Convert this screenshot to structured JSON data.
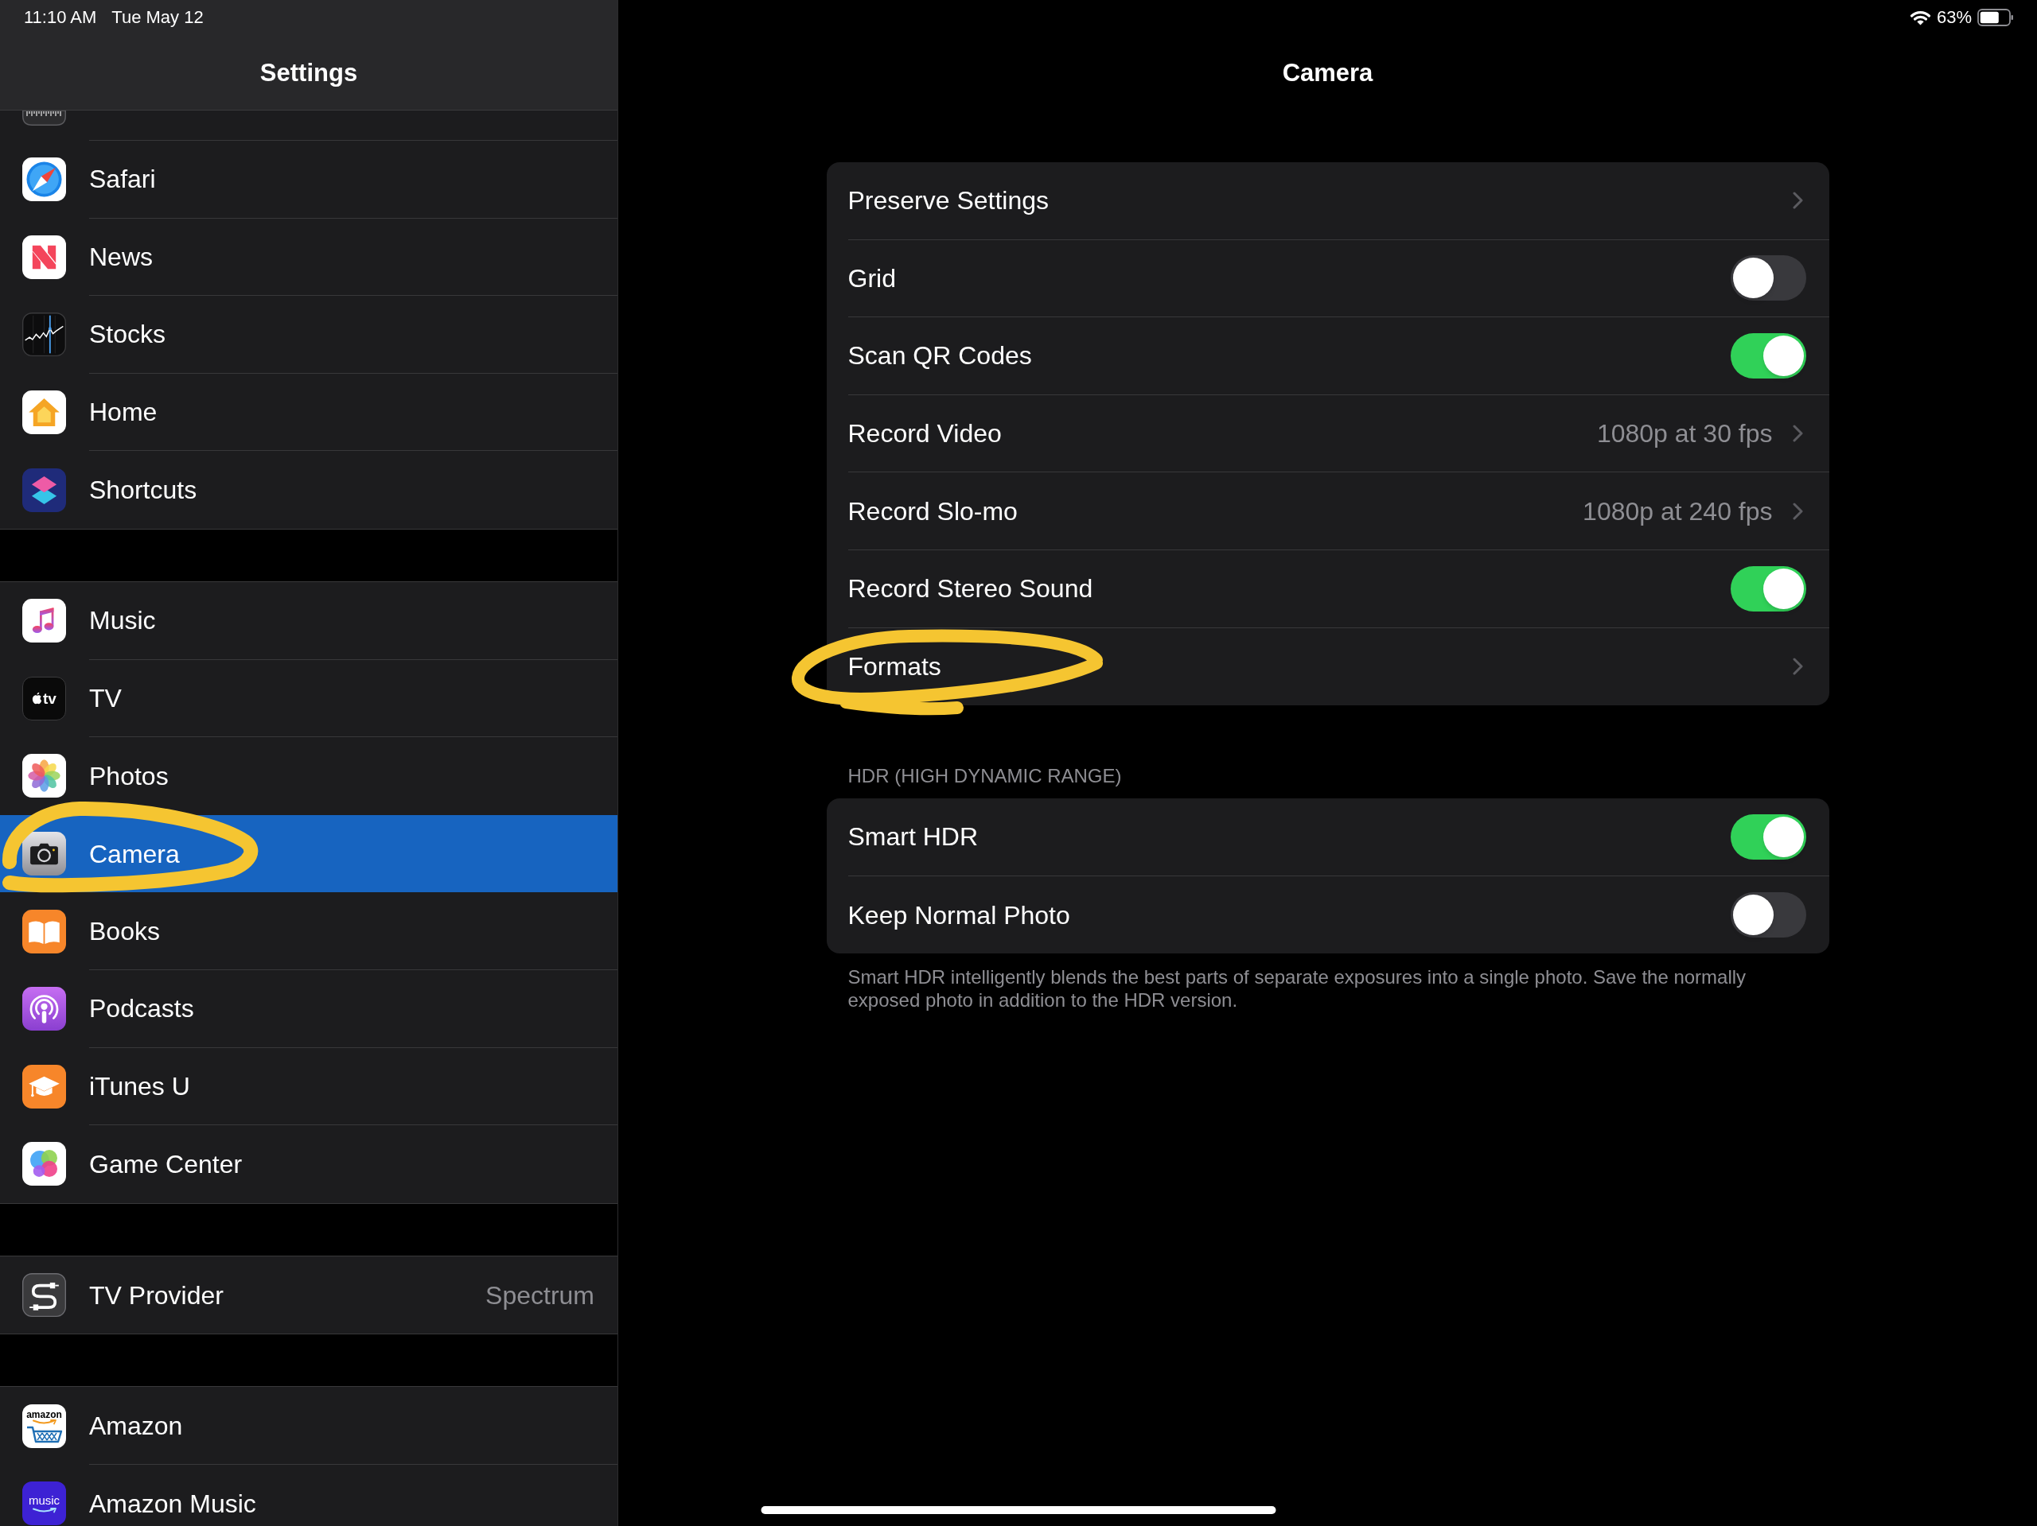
{
  "status_bar": {
    "time": "11:10 AM",
    "date": "Tue May 12",
    "battery": "63%"
  },
  "sidebar": {
    "title": "Settings",
    "groups": [
      {
        "items": [
          {
            "label": "Safari",
            "selected": false,
            "circled": false
          },
          {
            "label": "News",
            "selected": false,
            "circled": false
          },
          {
            "label": "Stocks",
            "selected": false,
            "circled": false
          },
          {
            "label": "Home",
            "selected": false,
            "circled": false
          },
          {
            "label": "Shortcuts",
            "selected": false,
            "circled": false
          }
        ]
      },
      {
        "items": [
          {
            "label": "Music",
            "selected": false,
            "circled": false
          },
          {
            "label": "TV",
            "icon_text": "tv",
            "selected": false,
            "circled": false
          },
          {
            "label": "Photos",
            "selected": false,
            "circled": false
          },
          {
            "label": "Camera",
            "selected": true,
            "circled": true
          },
          {
            "label": "Books",
            "selected": false,
            "circled": false
          },
          {
            "label": "Podcasts",
            "selected": false,
            "circled": false
          },
          {
            "label": "iTunes U",
            "selected": false,
            "circled": false
          },
          {
            "label": "Game Center",
            "selected": false,
            "circled": false
          }
        ]
      },
      {
        "items": [
          {
            "label": "TV Provider",
            "value": "Spectrum",
            "selected": false,
            "circled": false
          }
        ]
      },
      {
        "items": [
          {
            "label": "Amazon",
            "icon_text": "amazon",
            "selected": false,
            "circled": false
          },
          {
            "label": "Amazon Music",
            "icon_text": "music",
            "selected": false,
            "circled": false
          }
        ]
      }
    ]
  },
  "detail": {
    "title": "Camera",
    "sections": [
      {
        "rows": [
          {
            "kind": "link",
            "label": "Preserve Settings",
            "circled": false
          },
          {
            "kind": "toggle",
            "label": "Grid",
            "on": false,
            "circled": false
          },
          {
            "kind": "toggle",
            "label": "Scan QR Codes",
            "on": true,
            "circled": false
          },
          {
            "kind": "link",
            "label": "Record Video",
            "value": "1080p at 30 fps",
            "circled": false
          },
          {
            "kind": "link",
            "label": "Record Slo-mo",
            "value": "1080p at 240 fps",
            "circled": false
          },
          {
            "kind": "toggle",
            "label": "Record Stereo Sound",
            "on": true,
            "circled": false
          },
          {
            "kind": "link",
            "label": "Formats",
            "circled": true
          }
        ]
      },
      {
        "header": "HDR (HIGH DYNAMIC RANGE)",
        "rows": [
          {
            "kind": "toggle",
            "label": "Smart HDR",
            "on": true,
            "circled": false
          },
          {
            "kind": "toggle",
            "label": "Keep Normal Photo",
            "on": false,
            "circled": false
          }
        ],
        "footer": "Smart HDR intelligently blends the best parts of separate exposures into a single photo. Save the normally exposed photo in addition to the HDR version."
      }
    ]
  }
}
